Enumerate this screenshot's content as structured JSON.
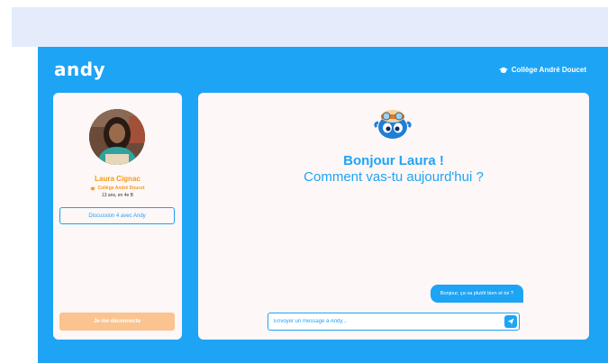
{
  "app": {
    "logo": "andy",
    "school": "Collège André Doucet",
    "brand_color": "#1ea4f5",
    "accent_color": "#f39a1c"
  },
  "user": {
    "name": "Laura Cignac",
    "school": "Collège André Doucet",
    "details": "13 ans, en 4e B"
  },
  "sidebar": {
    "discussion_label": "Discussion 4 avec Andy",
    "logout_label": "Je me déconnecte"
  },
  "chat": {
    "greeting_line1": "Bonjour Laura !",
    "greeting_line2": "Comment vas-tu aujourd'hui ?",
    "messages": [
      {
        "from": "user",
        "text": "Bonjour, ça va plutôt bien et toi ?"
      }
    ],
    "input_placeholder": "Envoyer un message à Andy..."
  },
  "icons": {
    "school": "graduation-cap-icon",
    "send": "send-arrow-icon",
    "mascot": "andy-mascot"
  }
}
